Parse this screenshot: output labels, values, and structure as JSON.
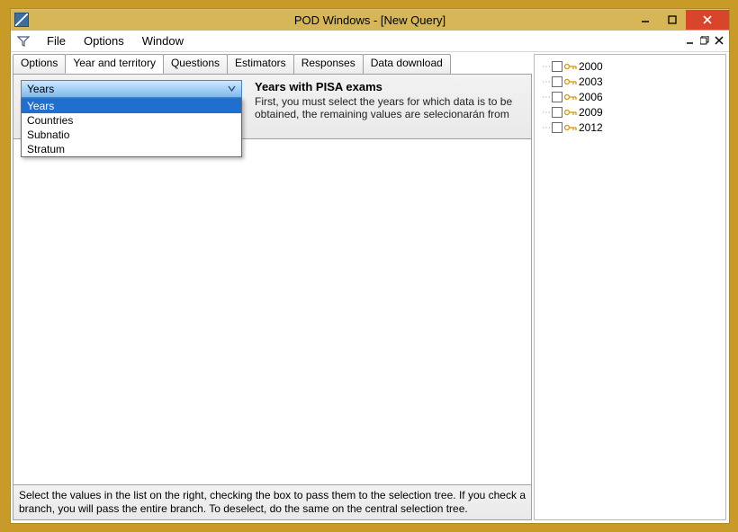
{
  "window": {
    "title": "POD Windows - [New Query]"
  },
  "menubar": {
    "file": "File",
    "options": "Options",
    "window": "Window"
  },
  "tabs": {
    "options": "Options",
    "year_territory": "Year and territory",
    "questions": "Questions",
    "estimators": "Estimators",
    "responses": "Responses",
    "data_download": "Data download",
    "active": "year_territory"
  },
  "combo": {
    "selected": "Years",
    "options": {
      "years": "Years",
      "countries": "Countries",
      "subnatio": "Subnatio",
      "stratum": "Stratum"
    }
  },
  "description": {
    "title": "Years with PISA exams",
    "body": "First, you must select the years for which data is to be obtained, the remaining values are selecionarán from"
  },
  "footer_hint": "Select the values in the list on the right, checking the box to pass them to the selection tree. If you check a branch, you will pass the entire branch. To deselect, do the same on the central selection tree.",
  "tree": {
    "items": [
      {
        "label": "2000"
      },
      {
        "label": "2003"
      },
      {
        "label": "2006"
      },
      {
        "label": "2009"
      },
      {
        "label": "2012"
      }
    ]
  }
}
